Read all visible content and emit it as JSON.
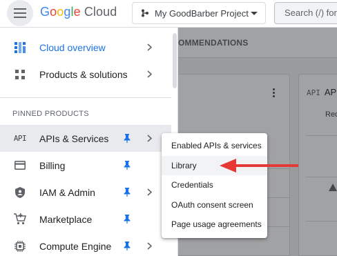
{
  "header": {
    "menu_icon": "hamburger-menu-icon",
    "logo": {
      "google": [
        "G",
        "o",
        "o",
        "g",
        "l",
        "e"
      ],
      "google_colors": [
        "#4285F4",
        "#EA4335",
        "#FBBC05",
        "#4285F4",
        "#34A853",
        "#EA4335"
      ],
      "product": "Cloud"
    },
    "project_selector": {
      "label": "My GoodBarber Project",
      "icon": "project-icon",
      "caret_icon": "caret-down-icon"
    },
    "search": {
      "placeholder": "Search (/) for resources"
    }
  },
  "background": {
    "tab_label": "OMMENDATIONS",
    "card2": {
      "icon_text": "API",
      "title": "AP",
      "row_text": "Rec"
    }
  },
  "sidenav": {
    "top_items": [
      {
        "label": "Cloud overview",
        "icon": "dashboard-icon",
        "highlight": true
      },
      {
        "label": "Products & solutions",
        "icon": "grid-icon",
        "highlight": false
      }
    ],
    "section_title": "PINNED PRODUCTS",
    "pinned_items": [
      {
        "label": "APIs & Services",
        "icon_text": "API",
        "icon": "api-icon",
        "pinned": true,
        "has_submenu": true,
        "active": true
      },
      {
        "label": "Billing",
        "icon": "billing-icon",
        "pinned": true,
        "has_submenu": false
      },
      {
        "label": "IAM & Admin",
        "icon": "shield-icon",
        "pinned": true,
        "has_submenu": true
      },
      {
        "label": "Marketplace",
        "icon": "cart-icon",
        "pinned": true,
        "has_submenu": false
      },
      {
        "label": "Compute Engine",
        "icon": "chip-icon",
        "pinned": true,
        "has_submenu": true
      }
    ]
  },
  "submenu": {
    "items": [
      {
        "label": "Enabled APIs & services"
      },
      {
        "label": "Library",
        "highlighted": true
      },
      {
        "label": "Credentials"
      },
      {
        "label": "OAuth consent screen"
      },
      {
        "label": "Page usage agreements"
      }
    ]
  },
  "annotation": {
    "arrow_color": "#e53935",
    "arrow_points_to": "Library"
  },
  "colors": {
    "accent": "#1a73e8",
    "pin": "#1a73e8",
    "text": "#202124",
    "muted": "#5f6368"
  }
}
